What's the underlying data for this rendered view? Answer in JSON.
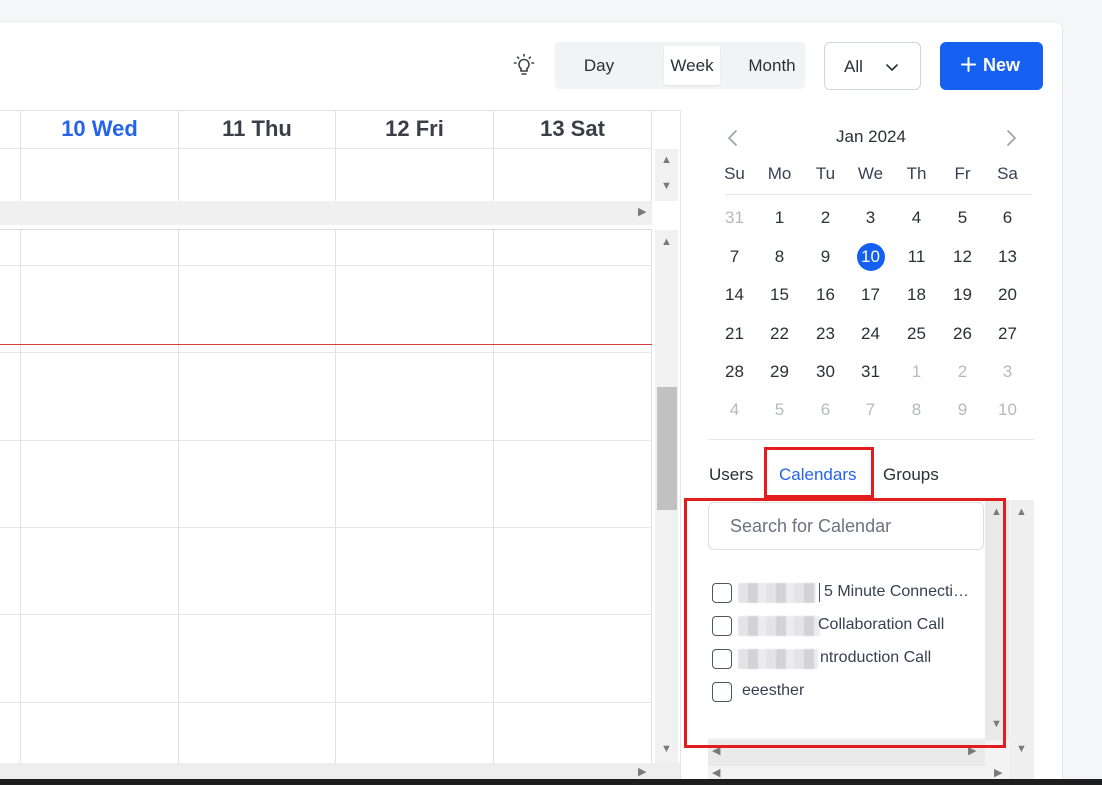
{
  "toolbar": {
    "theme_icon": "lightbulb-icon",
    "views": [
      "Day",
      "Week",
      "Month"
    ],
    "active_view": "Week",
    "filter_value": "All",
    "new_label": "New"
  },
  "week": {
    "days": [
      {
        "label": "10 Wed",
        "today": true
      },
      {
        "label": "11 Thu",
        "today": false
      },
      {
        "label": "12 Fri",
        "today": false
      },
      {
        "label": "13 Sat",
        "today": false
      }
    ]
  },
  "mini_calendar": {
    "title": "Jan 2024",
    "weekdays": [
      "Su",
      "Mo",
      "Tu",
      "We",
      "Th",
      "Fr",
      "Sa"
    ],
    "weeks": [
      [
        "31",
        "1",
        "2",
        "3",
        "4",
        "5",
        "6"
      ],
      [
        "7",
        "8",
        "9",
        "10",
        "11",
        "12",
        "13"
      ],
      [
        "14",
        "15",
        "16",
        "17",
        "18",
        "19",
        "20"
      ],
      [
        "21",
        "22",
        "23",
        "24",
        "25",
        "26",
        "27"
      ],
      [
        "28",
        "29",
        "30",
        "31",
        "1",
        "2",
        "3"
      ],
      [
        "4",
        "5",
        "6",
        "7",
        "8",
        "9",
        "10"
      ]
    ],
    "selected_day": "10"
  },
  "sidebar": {
    "tabs": [
      "Users",
      "Calendars",
      "Groups"
    ],
    "active_tab": "Calendars",
    "search_placeholder": "Search for Calendar",
    "calendars": [
      {
        "label": "5 Minute Connecti…",
        "checked": false
      },
      {
        "label": "Collaboration Call",
        "checked": false
      },
      {
        "label": "ntroduction Call",
        "checked": false
      },
      {
        "label": "eeesther",
        "checked": false
      }
    ]
  },
  "colors": {
    "accent": "#1560f0",
    "today_text": "#2563eb",
    "now_line": "#d83b3b",
    "highlight_box": "#e11d1d"
  }
}
